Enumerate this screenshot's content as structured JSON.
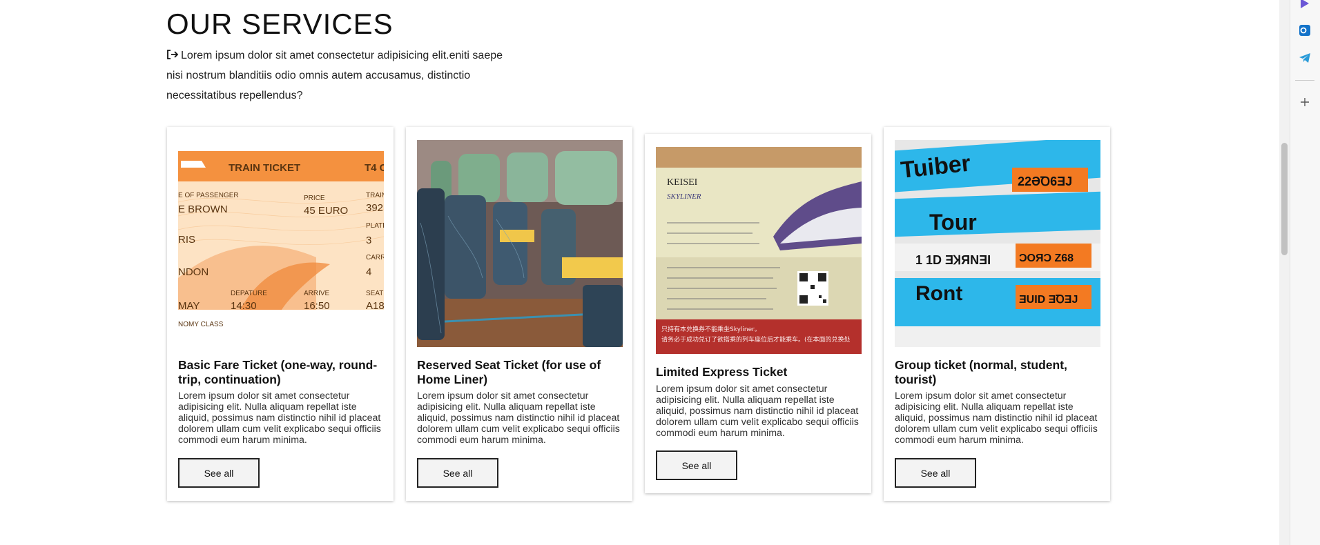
{
  "section": {
    "title": "OUR SERVICES",
    "intro": "Lorem ipsum dolor sit amet consectetur adipisicing elit.eniti saepe nisi nostrum blanditiis odio omnis autem accusamus, distinctio necessitatibus repellendus?",
    "intro_icon": "sign-in-icon"
  },
  "cards": [
    {
      "title": "Basic Fare Ticket (one-way, round-trip, continuation)",
      "desc": "Lorem ipsum dolor sit amet consectetur adipisicing elit. Nulla aliquam repellat iste aliquid, possimus nam distinctio nihil id placeat dolorem ullam cum velit explicabo sequi officiis commodi eum harum minima.",
      "button": "See all",
      "image": {
        "header": "TRAIN TICKET",
        "code": "T4 C",
        "name_label": "E OF PASSENGER",
        "name": "E BROWN",
        "price_label": "PRICE",
        "price": "45 EURO",
        "train_label": "TRAIN",
        "train": "392",
        "from": "RIS",
        "platform_label": "PLATF",
        "platform": "3",
        "to": "NDON",
        "car_label": "CARR",
        "car": "4",
        "departure_label": "DEPATURE",
        "departure": "14:30",
        "arrive_label": "ARRIVE",
        "arrive": "16:50",
        "seat_label": "SEAT",
        "seat": "A18",
        "month": "MAY",
        "class": "NOMY CLASS"
      }
    },
    {
      "title": "Reserved Seat Ticket (for use of Home Liner)",
      "desc": "Lorem ipsum dolor sit amet consectetur adipisicing elit. Nulla aliquam repellat iste aliquid, possimus nam distinctio nihil id placeat dolorem ullam cum velit explicabo sequi officiis commodi eum harum minima.",
      "button": "See all"
    },
    {
      "title": "Limited Express Ticket",
      "desc": "Lorem ipsum dolor sit amet consectetur adipisicing elit. Nulla aliquam repellat iste aliquid, possimus nam distinctio nihil id placeat dolorem ullam cum velit explicabo sequi officiis commodi eum harum minima.",
      "button": "See all",
      "image": {
        "brand": "KEISEI",
        "logo": "SKYLINER",
        "footer_1": "只持有本兑换券不能乘坐Skyliner。",
        "footer_2": "请务必于成功兑订了欲搭乘的列车座位后才能乘车。(在本面的兑换处"
      }
    },
    {
      "title": "Group ticket (normal, student, tourist)",
      "desc": "Lorem ipsum dolor sit amet consectetur adipisicing elit. Nulla aliquam repellat iste aliquid, possimus nam distinctio nihil id placeat dolorem ullam cum velit explicabo sequi officiis commodi eum harum minima.",
      "button": "See all",
      "image": {
        "line1": "Tuiber",
        "line2": "Tour",
        "line3": "Ront",
        "tag1": "22ƏꝹ6ƎJ",
        "tag2": "ƆOЯƆ Z68",
        "tag3": "ƎUID ƎꝹƎJ",
        "small": "1 1D ƎꞰЯNƎI"
      }
    }
  ],
  "rail_icons": [
    "copilot-icon",
    "outlook-icon",
    "telegram-icon",
    "plus-icon"
  ],
  "colors": {
    "card_shadow": "#bfbfbf",
    "button_bg": "#f3f3f3",
    "ticket_orange": "#f4913f",
    "ticket_blue": "#2db7ea"
  }
}
